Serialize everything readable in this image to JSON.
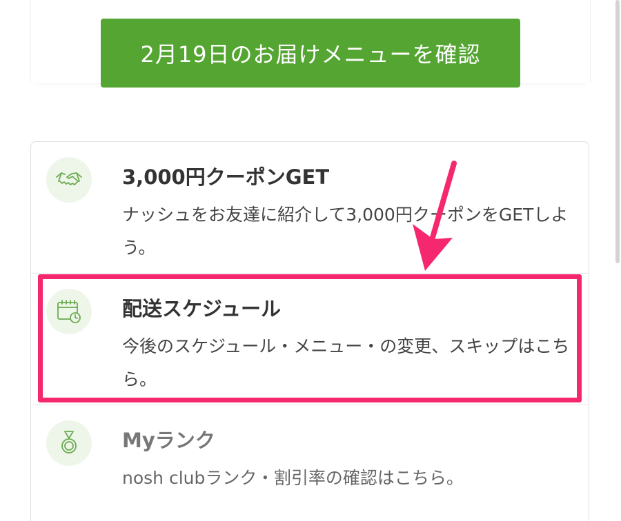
{
  "delivery_button": {
    "label": "2月19日のお届けメニューを確認"
  },
  "menu": [
    {
      "title": "3,000円クーポンGET",
      "description": "ナッシュをお友達に紹介して3,000円クーポンをGETしよう。",
      "icon": "handshake-icon"
    },
    {
      "title": "配送スケジュール",
      "description": "今後のスケジュール・メニュー・の変更、スキップはこちら。",
      "icon": "calendar-clock-icon"
    },
    {
      "title": "Myランク",
      "description": "nosh clubランク・割引率の確認はこちら。",
      "icon": "medal-icon"
    }
  ],
  "colors": {
    "accent_green": "#55a532",
    "icon_bg": "#eef6ea",
    "annotation_pink": "#f5286f"
  },
  "annotation": {
    "highlighted_item": "配送スケジュール",
    "arrow_color": "#f5286f"
  }
}
